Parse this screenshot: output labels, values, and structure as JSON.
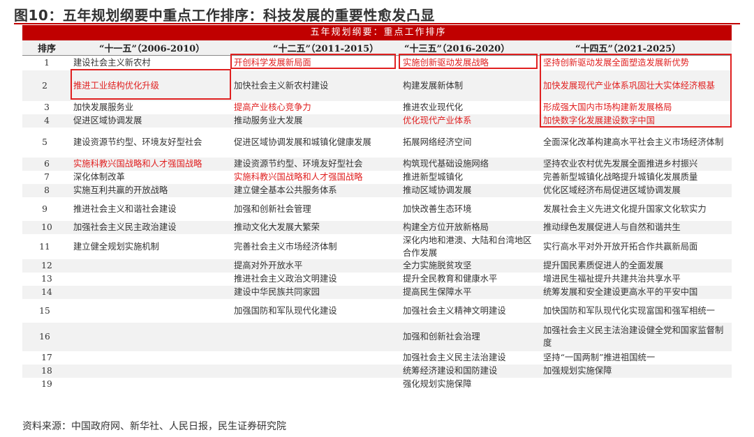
{
  "figure_title": "图10：五年规划纲要中重点工作排序：科技发展的重要性愈发凸显",
  "banner": "五年规划纲要：重点工作排序",
  "headers": {
    "rank": "排序",
    "p11": "“十一五”（2006-2010）",
    "p12": "“十二五”（2011-2015）",
    "p13": "“十三五”（2016-2020）",
    "p14": "“十四五”（2021-2025）"
  },
  "rows": [
    {
      "n": "1",
      "c1": "建设社会主义新农村",
      "c2": "开创科学发展新局面",
      "c3": "实施创新驱动发展战略",
      "c4": "坚持创新驱动发展全面塑造发展新优势"
    },
    {
      "n": "2",
      "c1": "推进工业结构优化升级",
      "c2": "加快社会主义新农村建设",
      "c3": "构建发展新体制",
      "c4": "加快发展现代产业体系巩固壮大实体经济根基"
    },
    {
      "n": "3",
      "c1": "加快发展服务业",
      "c2": "提高产业核心竞争力",
      "c3": "推进农业现代化",
      "c4": "形成强大国内市场构建新发展格局"
    },
    {
      "n": "4",
      "c1": "促进区域协调发展",
      "c2": "推动服务业大发展",
      "c3": "优化现代产业体系",
      "c4": "加快数字化发展建设数字中国"
    },
    {
      "n": "5",
      "c1": "建设资源节约型、环境友好型社会",
      "c2": "促进区域协调发展和城镇化健康发展",
      "c3": "拓展网络经济空间",
      "c4": "全面深化改革构建高水平社会主义市场经济体制"
    },
    {
      "n": "6",
      "c1": "实施科教兴国战略和人才强国战略",
      "c2": "建设资源节约型、环境友好型社会",
      "c3": "构筑现代基础设施网络",
      "c4": "坚持农业农村优先发展全面推进乡村振兴"
    },
    {
      "n": "7",
      "c1": "深化体制改革",
      "c2": "实施科教兴国战略和人才强国战略",
      "c3": "推进新型城镇化",
      "c4": "完善新型城镇化战略提升城镇化发展质量"
    },
    {
      "n": "8",
      "c1": "实施互利共赢的开放战略",
      "c2": "建立健全基本公共服务体系",
      "c3": "推动区域协调发展",
      "c4": "优化区域经济布局促进区域协调发展"
    },
    {
      "n": "9",
      "c1": "推进社会主义和谐社会建设",
      "c2": "加强和创新社会管理",
      "c3": "加快改善生态环境",
      "c4": "发展社会主义先进文化提升国家文化软实力"
    },
    {
      "n": "10",
      "c1": "加强社会主义民主政治建设",
      "c2": "推动文化大发展大繁荣",
      "c3": "构建全方位开放新格局",
      "c4": "推动绿色发展促进人与自然和谐共生"
    },
    {
      "n": "11",
      "c1": "建立健全规划实施机制",
      "c2": "完善社会主义市场经济体制",
      "c3": "深化内地和港澳、大陆和台湾地区合作发展",
      "c4": "实行高水平对外开放开拓合作共赢新局面"
    },
    {
      "n": "12",
      "c1": "",
      "c2": "提高对外开放水平",
      "c3": "全力实施脱贫攻坚",
      "c4": "提升国民素质促进人的全面发展"
    },
    {
      "n": "13",
      "c1": "",
      "c2": "推进社会主义政治文明建设",
      "c3": "提升全民教育和健康水平",
      "c4": "增进民生福祉提升共建共治共享水平"
    },
    {
      "n": "14",
      "c1": "",
      "c2": "建设中华民族共同家园",
      "c3": "提高民生保障水平",
      "c4": "统筹发展和安全建设更高水平的平安中国"
    },
    {
      "n": "15",
      "c1": "",
      "c2": "加强国防和军队现代化建设",
      "c3": "加强社会主义精神文明建设",
      "c4": "加快国防和军队现代化实现富国和强军相统一"
    },
    {
      "n": "16",
      "c1": "",
      "c2": "",
      "c3": "加强和创新社会治理",
      "c4": "加强社会主义民主法治建设健全党和国家监督制度"
    },
    {
      "n": "17",
      "c1": "",
      "c2": "",
      "c3": "加强社会主义民主法治建设",
      "c4": "坚持“一国两制”推进祖国统一"
    },
    {
      "n": "18",
      "c1": "",
      "c2": "",
      "c3": "统筹经济建设和国防建设",
      "c4": "加强规划实施保障"
    },
    {
      "n": "19",
      "c1": "",
      "c2": "",
      "c3": "强化规划实施保障",
      "c4": ""
    }
  ],
  "source": "资料来源：中国政府网、新华社、人民日报，民生证券研究院",
  "colors": {
    "accent": "#c00000",
    "highlight": "#e02020"
  }
}
